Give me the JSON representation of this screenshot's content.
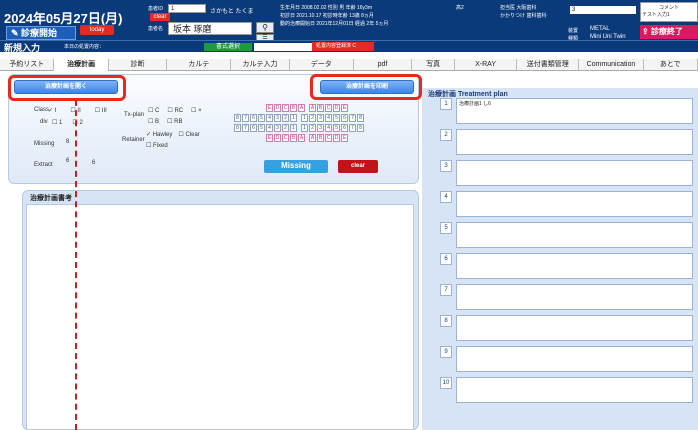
{
  "header": {
    "date": "2024年05月27日(月)",
    "start_label": "診療開始",
    "today_label": "today",
    "patient_no_label": "患者ID",
    "patient_id": "1",
    "kana": "さかもと たくま",
    "clear_tag": "clear",
    "name_label": "患者名",
    "patient_name": "坂本 琢磨",
    "search_icon": "search-icon",
    "menu_icon": "menu-icon",
    "birth": "生年月日 2008.02.02  性別 男  年齢 16y3m",
    "first_visit": "初診日 2021.10.17  初診時年齢 13歳 8ヵ月",
    "start_date": "動的治療開始日 2021年12月01日  経過 2年 5ヵ月",
    "grade": "高2",
    "doctor": "担当医 大阪歯科",
    "clinic": "かかりつけ 歯科歯科",
    "metal_label": "装置",
    "metal": "METAL",
    "appliance_label": "種類",
    "appliance": "Mini Uni Twin",
    "count": "3",
    "comment_label": "コメント",
    "comment": "テスト入力1",
    "end_label": "診療終了"
  },
  "subheader": {
    "title": "新規入力",
    "info": "本日の処置内容：",
    "format_select": "書式選択",
    "red_box": "処置内容登録済  C"
  },
  "tabs": [
    {
      "label": "予約リスト",
      "selected": false
    },
    {
      "label": "治療計画",
      "selected": true
    },
    {
      "label": "診断",
      "selected": false
    },
    {
      "label": "カルテ",
      "selected": false
    },
    {
      "label": "カルテ入力",
      "selected": false
    },
    {
      "label": "データ",
      "selected": false
    },
    {
      "label": "pdf",
      "selected": false
    },
    {
      "label": "写真",
      "selected": false
    },
    {
      "label": "X-RAY",
      "selected": false
    },
    {
      "label": "送付書類管理",
      "selected": false
    },
    {
      "label": "Communication",
      "selected": false
    },
    {
      "label": "あとで",
      "selected": false
    }
  ],
  "plan_panel": {
    "open_button": "治療計画を開く",
    "print_button": "治療計画を印刷",
    "class_label": "Class",
    "class_options": [
      "I",
      "II",
      "III"
    ],
    "div_label": "div",
    "div_options": [
      "1",
      "2"
    ],
    "txplan_label": "Tx-plan",
    "tx_options": [
      "C",
      "RC",
      "×",
      "B",
      "RB"
    ],
    "retainer_label": "Retainer",
    "retainer_options": [
      "Hawley",
      "Clear",
      "Fixed"
    ],
    "missing_label": "Missing",
    "missing_value": "8",
    "extract_label": "Extract",
    "extract_values": [
      "6",
      "6"
    ],
    "deciduous_letters": [
      "E",
      "D",
      "C",
      "B",
      "A",
      "A",
      "B",
      "C",
      "D",
      "E"
    ],
    "permanent_left": [
      "8",
      "7",
      "6",
      "5",
      "4",
      "3",
      "2",
      "1"
    ],
    "permanent_right": [
      "1",
      "2",
      "3",
      "4",
      "5",
      "6",
      "7",
      "8"
    ],
    "missing_button": "Missing",
    "clear_button": "clear"
  },
  "notes": {
    "title": "治療計画書考"
  },
  "treatment_plan": {
    "title": "治療計画  Treatment plan",
    "items": [
      {
        "num": "1",
        "text": "治療計画1 し6"
      },
      {
        "num": "2",
        "text": ""
      },
      {
        "num": "3",
        "text": ""
      },
      {
        "num": "4",
        "text": ""
      },
      {
        "num": "5",
        "text": ""
      },
      {
        "num": "6",
        "text": ""
      },
      {
        "num": "7",
        "text": ""
      },
      {
        "num": "8",
        "text": ""
      },
      {
        "num": "9",
        "text": ""
      },
      {
        "num": "10",
        "text": ""
      }
    ]
  }
}
